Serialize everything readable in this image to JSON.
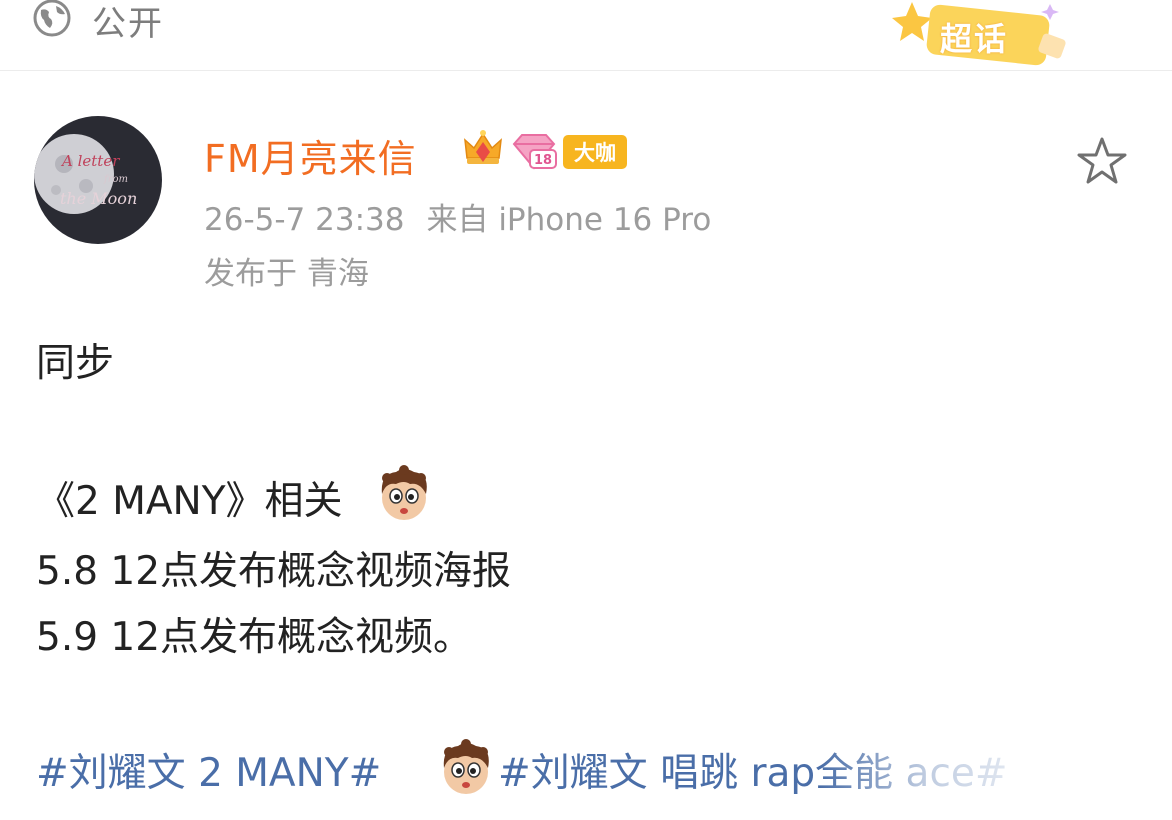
{
  "header": {
    "visibility_icon": "globe-icon",
    "visibility_label": "公开",
    "supertopic_label": "超话"
  },
  "post": {
    "author": {
      "name": "FM月亮来信",
      "avatar_text_line1": "A letter",
      "avatar_text_line2": "from",
      "avatar_text_line3": "the Moon",
      "crown_icon": "crown-icon",
      "level_icon": "diamond-level-icon",
      "level_number": "18",
      "badge_label": "大咖"
    },
    "timestamp": "26-5-7 23:38",
    "source": "来自 iPhone 16 Pro",
    "location": "发布于 青海",
    "favorite_icon": "star-outline-icon",
    "body": {
      "line1": "同步",
      "line2": "《2 MANY》相关",
      "line3": "5.8 12点发布概念视频海报",
      "line4": "5.9 12点发布概念视频。"
    },
    "hashtags": [
      "#刘耀文 2 MANY#",
      "#刘耀文 唱跳 rap全能 ace#"
    ],
    "colors": {
      "username": "#f26d22",
      "meta": "#9c9c9c",
      "hashtag": "#4a6ea8",
      "badge": "#f7b51f",
      "supertopic": "#f9c23c"
    }
  }
}
